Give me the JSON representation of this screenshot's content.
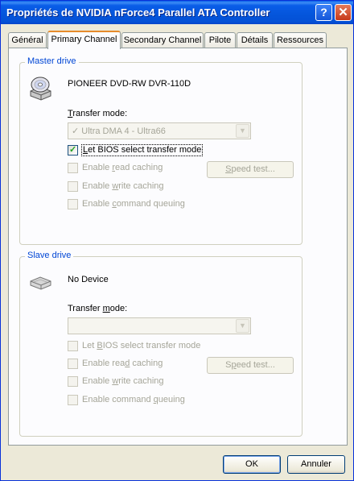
{
  "window": {
    "title": "Propriétés de NVIDIA nForce4 Parallel ATA Controller",
    "help_glyph": "?",
    "close_glyph": "✕"
  },
  "tabs": [
    {
      "label": "Général"
    },
    {
      "label": "Primary Channel",
      "active": true
    },
    {
      "label": "Secondary Channel"
    },
    {
      "label": "Pilote"
    },
    {
      "label": "Détails"
    },
    {
      "label": "Ressources"
    }
  ],
  "master": {
    "legend": "Master drive",
    "icon": "cd-drive-icon",
    "device_name": "PIONEER DVD-RW  DVR-110D",
    "transfer_label_u": "T",
    "transfer_label_rest": "ransfer mode:",
    "transfer_value": "Ultra DMA 4 - Ultra66",
    "transfer_check_glyph": "✓",
    "bios": {
      "pre": "",
      "u": "L",
      "post": "et BIOS select transfer mode",
      "checked": true,
      "enabled": true
    },
    "read_caching": {
      "pre": "Enable ",
      "u": "r",
      "post": "ead caching",
      "checked": false,
      "enabled": false
    },
    "write_caching": {
      "pre": "Enable ",
      "u": "w",
      "post": "rite caching",
      "checked": false,
      "enabled": false
    },
    "command_queuing": {
      "pre": "Enable ",
      "u": "c",
      "post": "ommand queuing",
      "checked": false,
      "enabled": false
    },
    "speed_test": {
      "u": "S",
      "rest": "peed test..."
    }
  },
  "slave": {
    "legend": "Slave drive",
    "icon": "drive-icon",
    "device_name": "No Device",
    "transfer_label_pre": "Transfer ",
    "transfer_label_u": "m",
    "transfer_label_post": "ode:",
    "transfer_value": "",
    "bios": {
      "pre": "Let ",
      "u": "B",
      "post": "IOS select transfer mode",
      "checked": false,
      "enabled": false
    },
    "read_caching": {
      "pre": "Enable rea",
      "u": "d",
      "post": " caching",
      "checked": false,
      "enabled": false
    },
    "write_caching": {
      "pre": "Enable ",
      "u": "w",
      "post": "rite caching",
      "checked": false,
      "enabled": false
    },
    "command_queuing": {
      "pre": "Enable command ",
      "u": "q",
      "post": "ueuing",
      "checked": false,
      "enabled": false
    },
    "speed_test": {
      "pre": "S",
      "u": "p",
      "post": "eed test..."
    }
  },
  "buttons": {
    "ok": "OK",
    "cancel": "Annuler"
  },
  "colors": {
    "title_bar": "#0455db",
    "group_legend": "#0046d5",
    "active_tab_accent": "#e68b2c",
    "dialog_bg": "#ece9d8"
  }
}
